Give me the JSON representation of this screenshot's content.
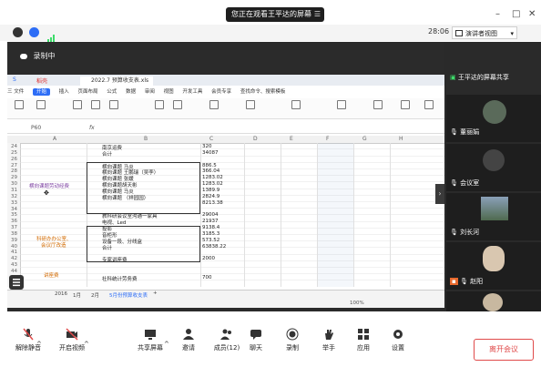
{
  "window": {
    "sharing_banner": "您正在观看王平达的屏幕",
    "controls": {
      "minimize": "–",
      "maximize": "□",
      "close": "✕"
    }
  },
  "meeting_bar": {
    "timer": "28:06",
    "view_button": "演讲者视图",
    "view_dropdown": "▾"
  },
  "recording_label": "录制中",
  "shared_screen": {
    "tabs": {
      "first": "S",
      "second": "稻壳",
      "file": "2022.7 预算收支表.xls"
    },
    "menu": [
      "三 文件",
      "开始",
      "插入",
      "页面布局",
      "公式",
      "数据",
      "审阅",
      "视图",
      "开发工具",
      "会员专享",
      "查找命令、搜索模板"
    ],
    "active_menu": "开始",
    "cell_ref": "P60",
    "fx": "fx",
    "columns": [
      "A",
      "B",
      "C",
      "D",
      "E",
      "F",
      "G",
      "H"
    ],
    "rows": [
      "24",
      "25",
      "26",
      "27",
      "28",
      "29",
      "30",
      "31",
      "32",
      "33",
      "34",
      "35",
      "36",
      "37",
      "38",
      "39",
      "40",
      "41",
      "42",
      "43",
      "44",
      "45",
      "46"
    ],
    "cells": [
      {
        "b": "南京运费",
        "c": "320"
      },
      {
        "b": "合计",
        "c": "34087"
      },
      {
        "b": "",
        "c": ""
      },
      {
        "b": "横向课题  马炎",
        "c": "886.5"
      },
      {
        "b": "横向课题  王鹏瑞（吴李）",
        "c": "366.04"
      },
      {
        "b": "横向课题  张媛",
        "c": "1283.02"
      },
      {
        "b": "横向课题胡天彬",
        "c": "1283.02"
      },
      {
        "b": "横向课题  马炎",
        "c": "1389.9"
      },
      {
        "b": "横向课题  （祥园园）",
        "c": "2824.9"
      },
      {
        "b": "",
        "c": "8213.38"
      },
      {
        "b": "",
        "c": ""
      },
      {
        "b": "教科研会议室沟通一家具",
        "c": "29004"
      },
      {
        "b": "电视、Led",
        "c": "21937"
      },
      {
        "b": "投影",
        "c": "9138.4"
      },
      {
        "b": "音柜形",
        "c": "3185.3"
      },
      {
        "b": "设备一段、分线盒",
        "c": "573.52"
      },
      {
        "b": "合计",
        "c": "63838.22"
      },
      {
        "b": "",
        "c": ""
      },
      {
        "b": "专家讲座费",
        "c": "2000"
      },
      {
        "b": "",
        "c": ""
      },
      {
        "b": "",
        "c": ""
      },
      {
        "b": "社科统计劳务费",
        "c": "700"
      },
      {
        "b": "",
        "c": ""
      }
    ],
    "merged_labels": {
      "horizontal": "横向课题劳动经费",
      "research_office_line1": "科研办办公室、",
      "research_office_line2": "会议厅改造",
      "lecture": "讲座费"
    },
    "sheet_tabs": [
      "2016",
      "1月",
      "2月",
      "5月份预算收支表"
    ],
    "zoom": "100%"
  },
  "participants": [
    {
      "name": "王平达的屏幕共享"
    },
    {
      "name": "董丽娟"
    },
    {
      "name": "会议室"
    },
    {
      "name": "刘长河"
    },
    {
      "name": "赵阳"
    },
    {
      "name": ""
    }
  ],
  "bottom_bar": {
    "mute": "解除静音",
    "video": "开启视频",
    "share": "共享屏幕",
    "invite": "邀请",
    "members": "成员(12)",
    "chat": "聊天",
    "record": "录制",
    "raise_hand": "举手",
    "apps": "应用",
    "settings": "设置",
    "leave": "离开会议"
  },
  "colors": {
    "accent": "#2d6df6",
    "leave": "#e04a4a",
    "mic_on": "#3ddc6a"
  }
}
